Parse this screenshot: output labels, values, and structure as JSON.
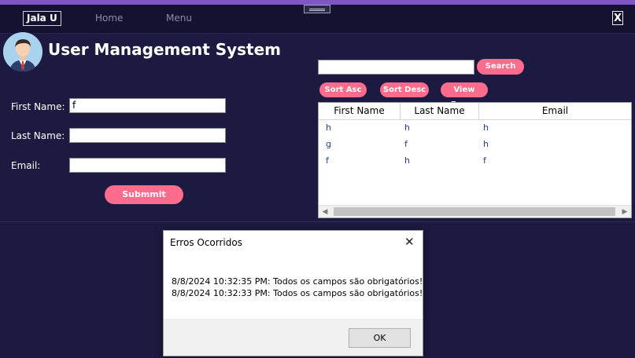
{
  "app": {
    "brand": "Jala U",
    "nav_items": [
      "Home",
      "Menu"
    ],
    "close_label": "X",
    "title": "User Management System"
  },
  "form": {
    "first_name_label": "First Name:",
    "first_name_value": "f",
    "last_name_label": "Last Name:",
    "last_name_value": "",
    "email_label": "Email:",
    "email_value": "",
    "submit_label": "Submmit"
  },
  "search": {
    "value": "",
    "button_label": "Search"
  },
  "toolbar": {
    "sort_asc_label": "Sort Asc",
    "sort_desc_label": "Sort Desc",
    "view_errors_label": "View Errors"
  },
  "table": {
    "columns": [
      "First Name",
      "Last Name",
      "Email"
    ],
    "rows": [
      [
        "h",
        "h",
        "h"
      ],
      [
        "g",
        "f",
        "h"
      ],
      [
        "f",
        "h",
        "f"
      ]
    ]
  },
  "dialog": {
    "title": "Erros Ocorridos",
    "close_label": "✕",
    "messages": [
      "8/8/2024 10:32:35 PM: Todos os campos são obrigatórios!",
      "8/8/2024 10:32:33 PM: Todos os campos são obrigatórios!"
    ],
    "ok_label": "OK"
  },
  "colors": {
    "background": "#1d1a41",
    "accent_button": "#fe6c8d",
    "nav_bar": "#141231"
  }
}
